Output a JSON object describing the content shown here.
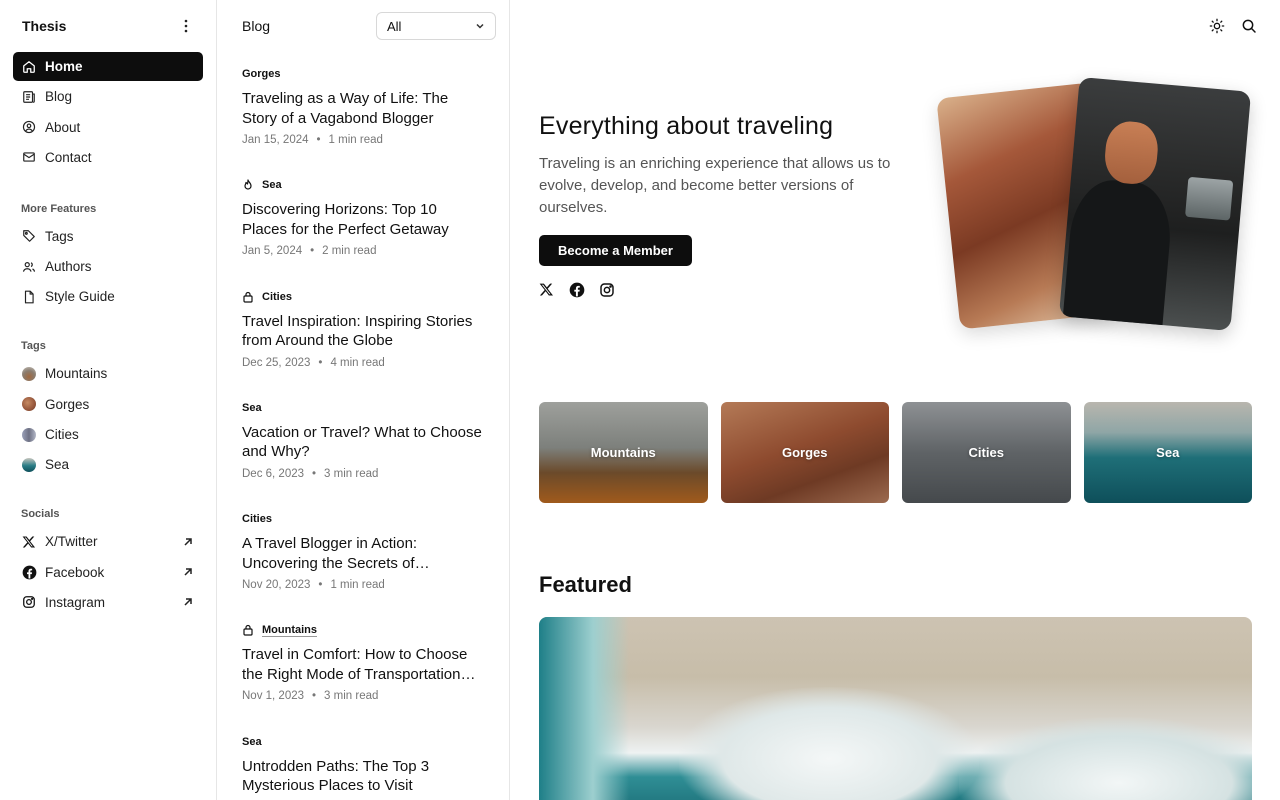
{
  "app": {
    "brand": "Thesis"
  },
  "sidebar": {
    "nav": [
      {
        "label": "Home",
        "icon": "home-icon",
        "active": true
      },
      {
        "label": "Blog",
        "icon": "newspaper-icon",
        "active": false
      },
      {
        "label": "About",
        "icon": "user-circle-icon",
        "active": false
      },
      {
        "label": "Contact",
        "icon": "mail-icon",
        "active": false
      }
    ],
    "more_title": "More Features",
    "more": [
      {
        "label": "Tags",
        "icon": "tag-icon"
      },
      {
        "label": "Authors",
        "icon": "users-icon"
      },
      {
        "label": "Style Guide",
        "icon": "file-icon"
      }
    ],
    "tags_title": "Tags",
    "tags": [
      {
        "label": "Mountains",
        "color": "#8a7d70"
      },
      {
        "label": "Gorges",
        "color": "#9a5a3e"
      },
      {
        "label": "Cities",
        "color": "#7b7f95"
      },
      {
        "label": "Sea",
        "color": "#2a7d86"
      }
    ],
    "socials_title": "Socials",
    "socials": [
      {
        "label": "X/Twitter",
        "icon": "x-icon"
      },
      {
        "label": "Facebook",
        "icon": "facebook-icon"
      },
      {
        "label": "Instagram",
        "icon": "instagram-icon"
      }
    ]
  },
  "list": {
    "title": "Blog",
    "filter_value": "All",
    "posts": [
      {
        "tag": "Gorges",
        "tag_icon": "",
        "title": "Traveling as a Way of Life: The Story of a Vagabond Blogger",
        "date": "Jan 15, 2024",
        "read": "1 min read"
      },
      {
        "tag": "Sea",
        "tag_icon": "flame-icon",
        "title": "Discovering Horizons: Top 10 Places for the Perfect Getaway",
        "date": "Jan 5, 2024",
        "read": "2 min read"
      },
      {
        "tag": "Cities",
        "tag_icon": "lock-icon",
        "title": "Travel Inspiration: Inspiring Stories from Around the Globe",
        "date": "Dec 25, 2023",
        "read": "4 min read"
      },
      {
        "tag": "Sea",
        "tag_icon": "",
        "title": "Vacation or Travel? What to Choose and Why?",
        "date": "Dec 6, 2023",
        "read": "3 min read"
      },
      {
        "tag": "Cities",
        "tag_icon": "",
        "title": "A Travel Blogger in Action: Uncovering the Secrets of…",
        "date": "Nov 20, 2023",
        "read": "1 min read"
      },
      {
        "tag": "Mountains",
        "tag_icon": "lock-icon",
        "title": "Travel in Comfort: How to Choose the Right Mode of Transportation…",
        "date": "Nov 1, 2023",
        "read": "3 min read"
      },
      {
        "tag": "Sea",
        "tag_icon": "",
        "title": "Untrodden Paths: The Top 3 Mysterious Places to Visit",
        "date": "",
        "read": ""
      }
    ]
  },
  "main": {
    "hero_title": "Everything about traveling",
    "hero_desc": "Traveling is an enriching experience that allows us to evolve, develop, and become better versions of ourselves.",
    "cta": "Become a Member",
    "categories": [
      "Mountains",
      "Gorges",
      "Cities",
      "Sea"
    ],
    "featured_title": "Featured"
  }
}
